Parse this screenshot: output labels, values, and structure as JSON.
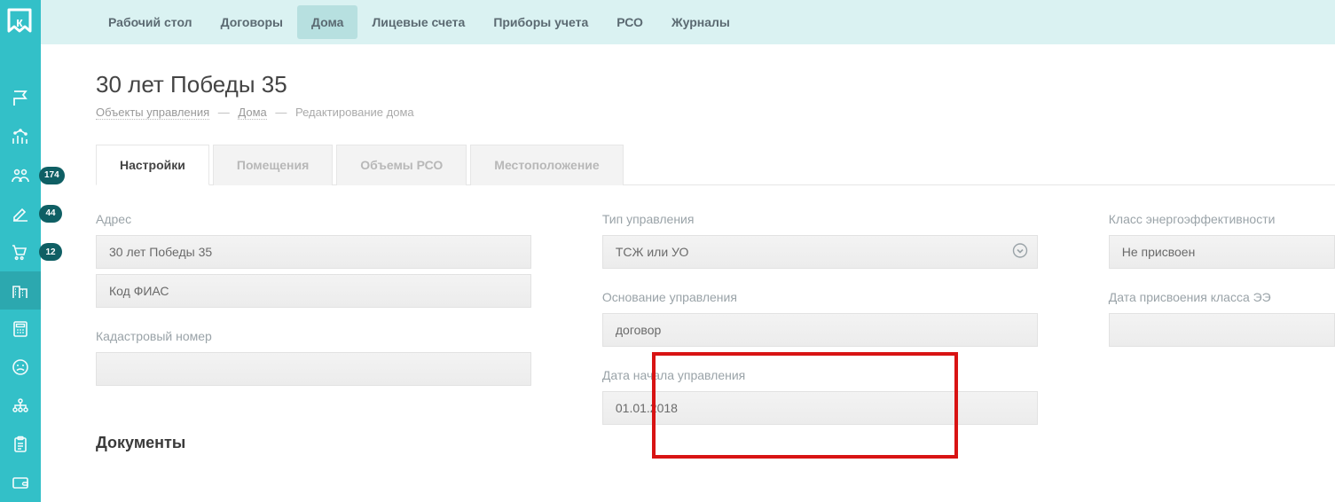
{
  "sidebar": {
    "badges": {
      "users": "174",
      "edit": "44",
      "cart": "12"
    }
  },
  "topnav": {
    "items": [
      {
        "label": "Рабочий стол"
      },
      {
        "label": "Договоры"
      },
      {
        "label": "Дома"
      },
      {
        "label": "Лицевые счета"
      },
      {
        "label": "Приборы учета"
      },
      {
        "label": "РСО"
      },
      {
        "label": "Журналы"
      }
    ]
  },
  "page": {
    "title": "30 лет Победы 35",
    "breadcrumb": {
      "a": "Объекты управления",
      "b": "Дома",
      "current": "Редактирование дома"
    }
  },
  "tabs": [
    {
      "label": "Настройки"
    },
    {
      "label": "Помещения"
    },
    {
      "label": "Объемы РСО"
    },
    {
      "label": "Местоположение"
    }
  ],
  "form": {
    "address_label": "Адрес",
    "address_value": "30 лет Победы 35",
    "fias_label": "Код ФИАС",
    "cadastral_label": "Кадастровый номер",
    "mgmt_type_label": "Тип управления",
    "mgmt_type_value": "ТСЖ или УО",
    "mgmt_basis_label": "Основание управления",
    "mgmt_basis_value": "договор",
    "mgmt_start_label": "Дата начала управления",
    "mgmt_start_value": "01.01.2018",
    "energy_class_label": "Класс энергоэффективности",
    "energy_class_value": "Не присвоен",
    "energy_date_label": "Дата присвоения класса ЭЭ"
  },
  "documents_title": "Документы"
}
